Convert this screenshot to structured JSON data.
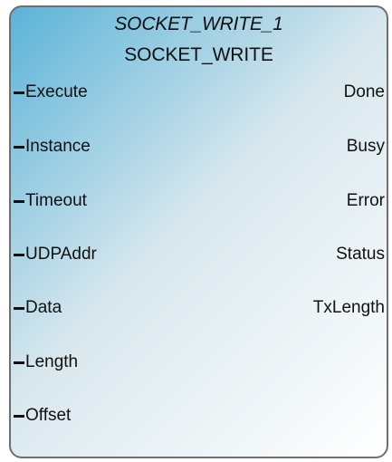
{
  "block": {
    "instance_name": "SOCKET_WRITE_1",
    "type_name": "SOCKET_WRITE",
    "inputs": [
      {
        "label": "Execute"
      },
      {
        "label": "Instance"
      },
      {
        "label": "Timeout"
      },
      {
        "label": "UDPAddr"
      },
      {
        "label": "Data"
      },
      {
        "label": "Length"
      },
      {
        "label": "Offset"
      }
    ],
    "outputs": [
      {
        "label": "Done"
      },
      {
        "label": "Busy"
      },
      {
        "label": "Error"
      },
      {
        "label": "Status"
      },
      {
        "label": "TxLength"
      }
    ]
  },
  "colors": {
    "gradient_start": "#5bb3d8",
    "gradient_mid": "#d9e8ee",
    "gradient_end": "#ffffff",
    "border": "#6f6f6f",
    "text": "#111111"
  }
}
